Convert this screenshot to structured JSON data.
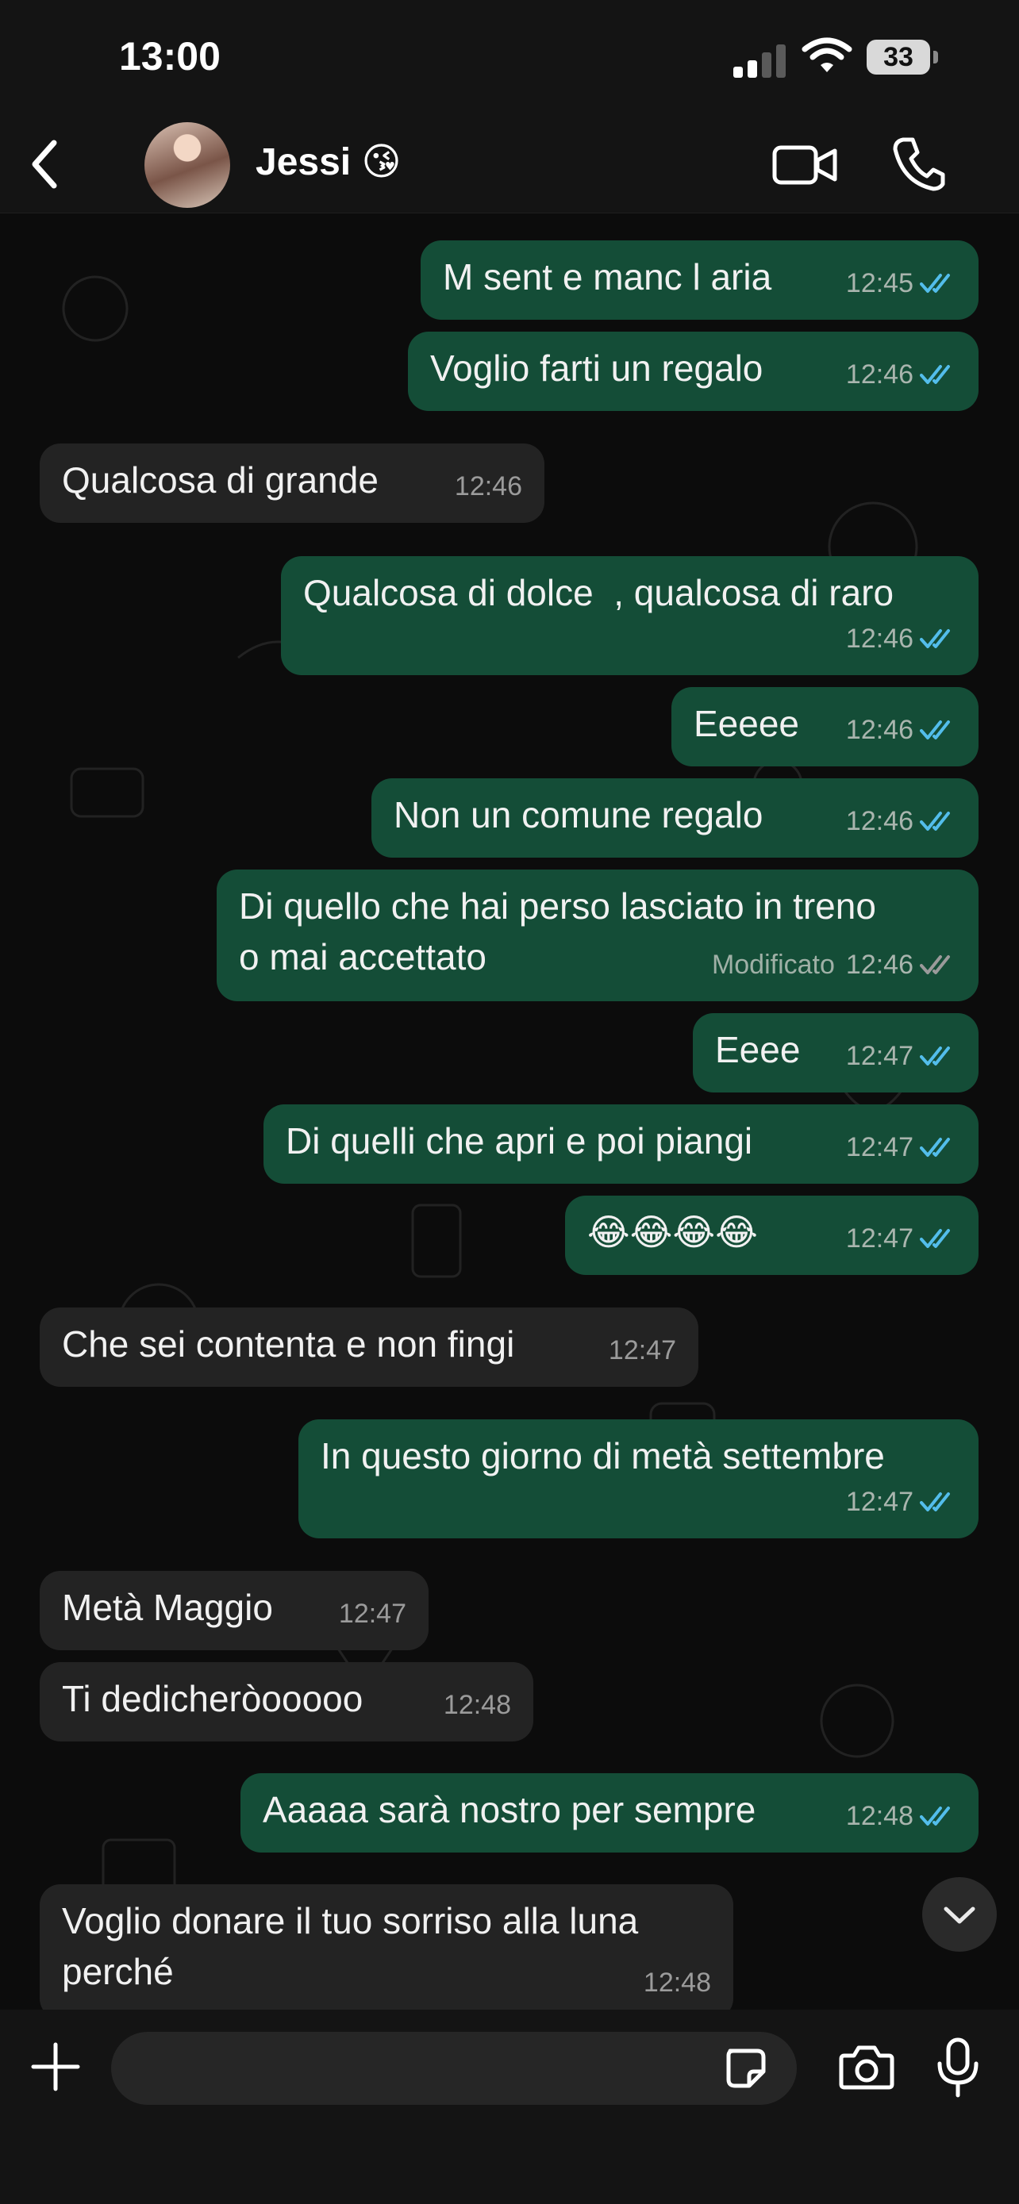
{
  "status_bar": {
    "time": "13:00",
    "battery": "33",
    "icons": [
      "signal-icon",
      "wifi-icon",
      "battery-icon"
    ]
  },
  "header": {
    "contact_name": "Jessi 😘",
    "icons": [
      "back-icon",
      "avatar",
      "video-call-icon",
      "phone-call-icon"
    ]
  },
  "colors": {
    "outgoing_bubble": "#144d37",
    "incoming_bubble": "#232323",
    "read_ticks": "#53bdeb",
    "sent_ticks": "#9a9a9a"
  },
  "messages": [
    {
      "dir": "out",
      "text": "M sent e manc l aria",
      "time": "12:45",
      "status": "read"
    },
    {
      "dir": "out",
      "text": "Voglio farti un regalo",
      "time": "12:46",
      "status": "read"
    },
    {
      "dir": "in",
      "text": "Qualcosa di grande",
      "time": "12:46"
    },
    {
      "dir": "out",
      "text": "Qualcosa di dolce  , qualcosa di raro",
      "time": "12:46",
      "status": "read"
    },
    {
      "dir": "out",
      "text": "Eeeee",
      "time": "12:46",
      "status": "read"
    },
    {
      "dir": "out",
      "text": "Non un comune regalo",
      "time": "12:46",
      "status": "read"
    },
    {
      "dir": "out",
      "text": "Di quello che hai perso lasciato in treno\no mai accettato",
      "time": "12:46",
      "status": "delivered",
      "edited": "Modificato"
    },
    {
      "dir": "out",
      "text": "Eeee",
      "time": "12:47",
      "status": "read"
    },
    {
      "dir": "out",
      "text": "Di quelli che apri e poi piangi",
      "time": "12:47",
      "status": "read"
    },
    {
      "dir": "out",
      "text": "😂😂😂😂",
      "time": "12:47",
      "status": "read"
    },
    {
      "dir": "in",
      "text": "Che sei contenta e non fingi",
      "time": "12:47"
    },
    {
      "dir": "out",
      "text": "In questo giorno di metà settembre",
      "time": "12:47",
      "status": "read"
    },
    {
      "dir": "in",
      "text": "Metà Maggio",
      "time": "12:47"
    },
    {
      "dir": "in",
      "text": "Ti dedicheròooooo",
      "time": "12:48"
    },
    {
      "dir": "out",
      "text": "Aaaaa sarà nostro per sempre",
      "time": "12:48",
      "status": "read"
    },
    {
      "dir": "in",
      "text": "Voglio donare il tuo sorriso alla luna\nperché",
      "time": "12:48"
    }
  ],
  "input_bar": {
    "placeholder": "",
    "icons": [
      "plus-icon",
      "sticker-icon",
      "camera-icon",
      "microphone-icon"
    ]
  }
}
